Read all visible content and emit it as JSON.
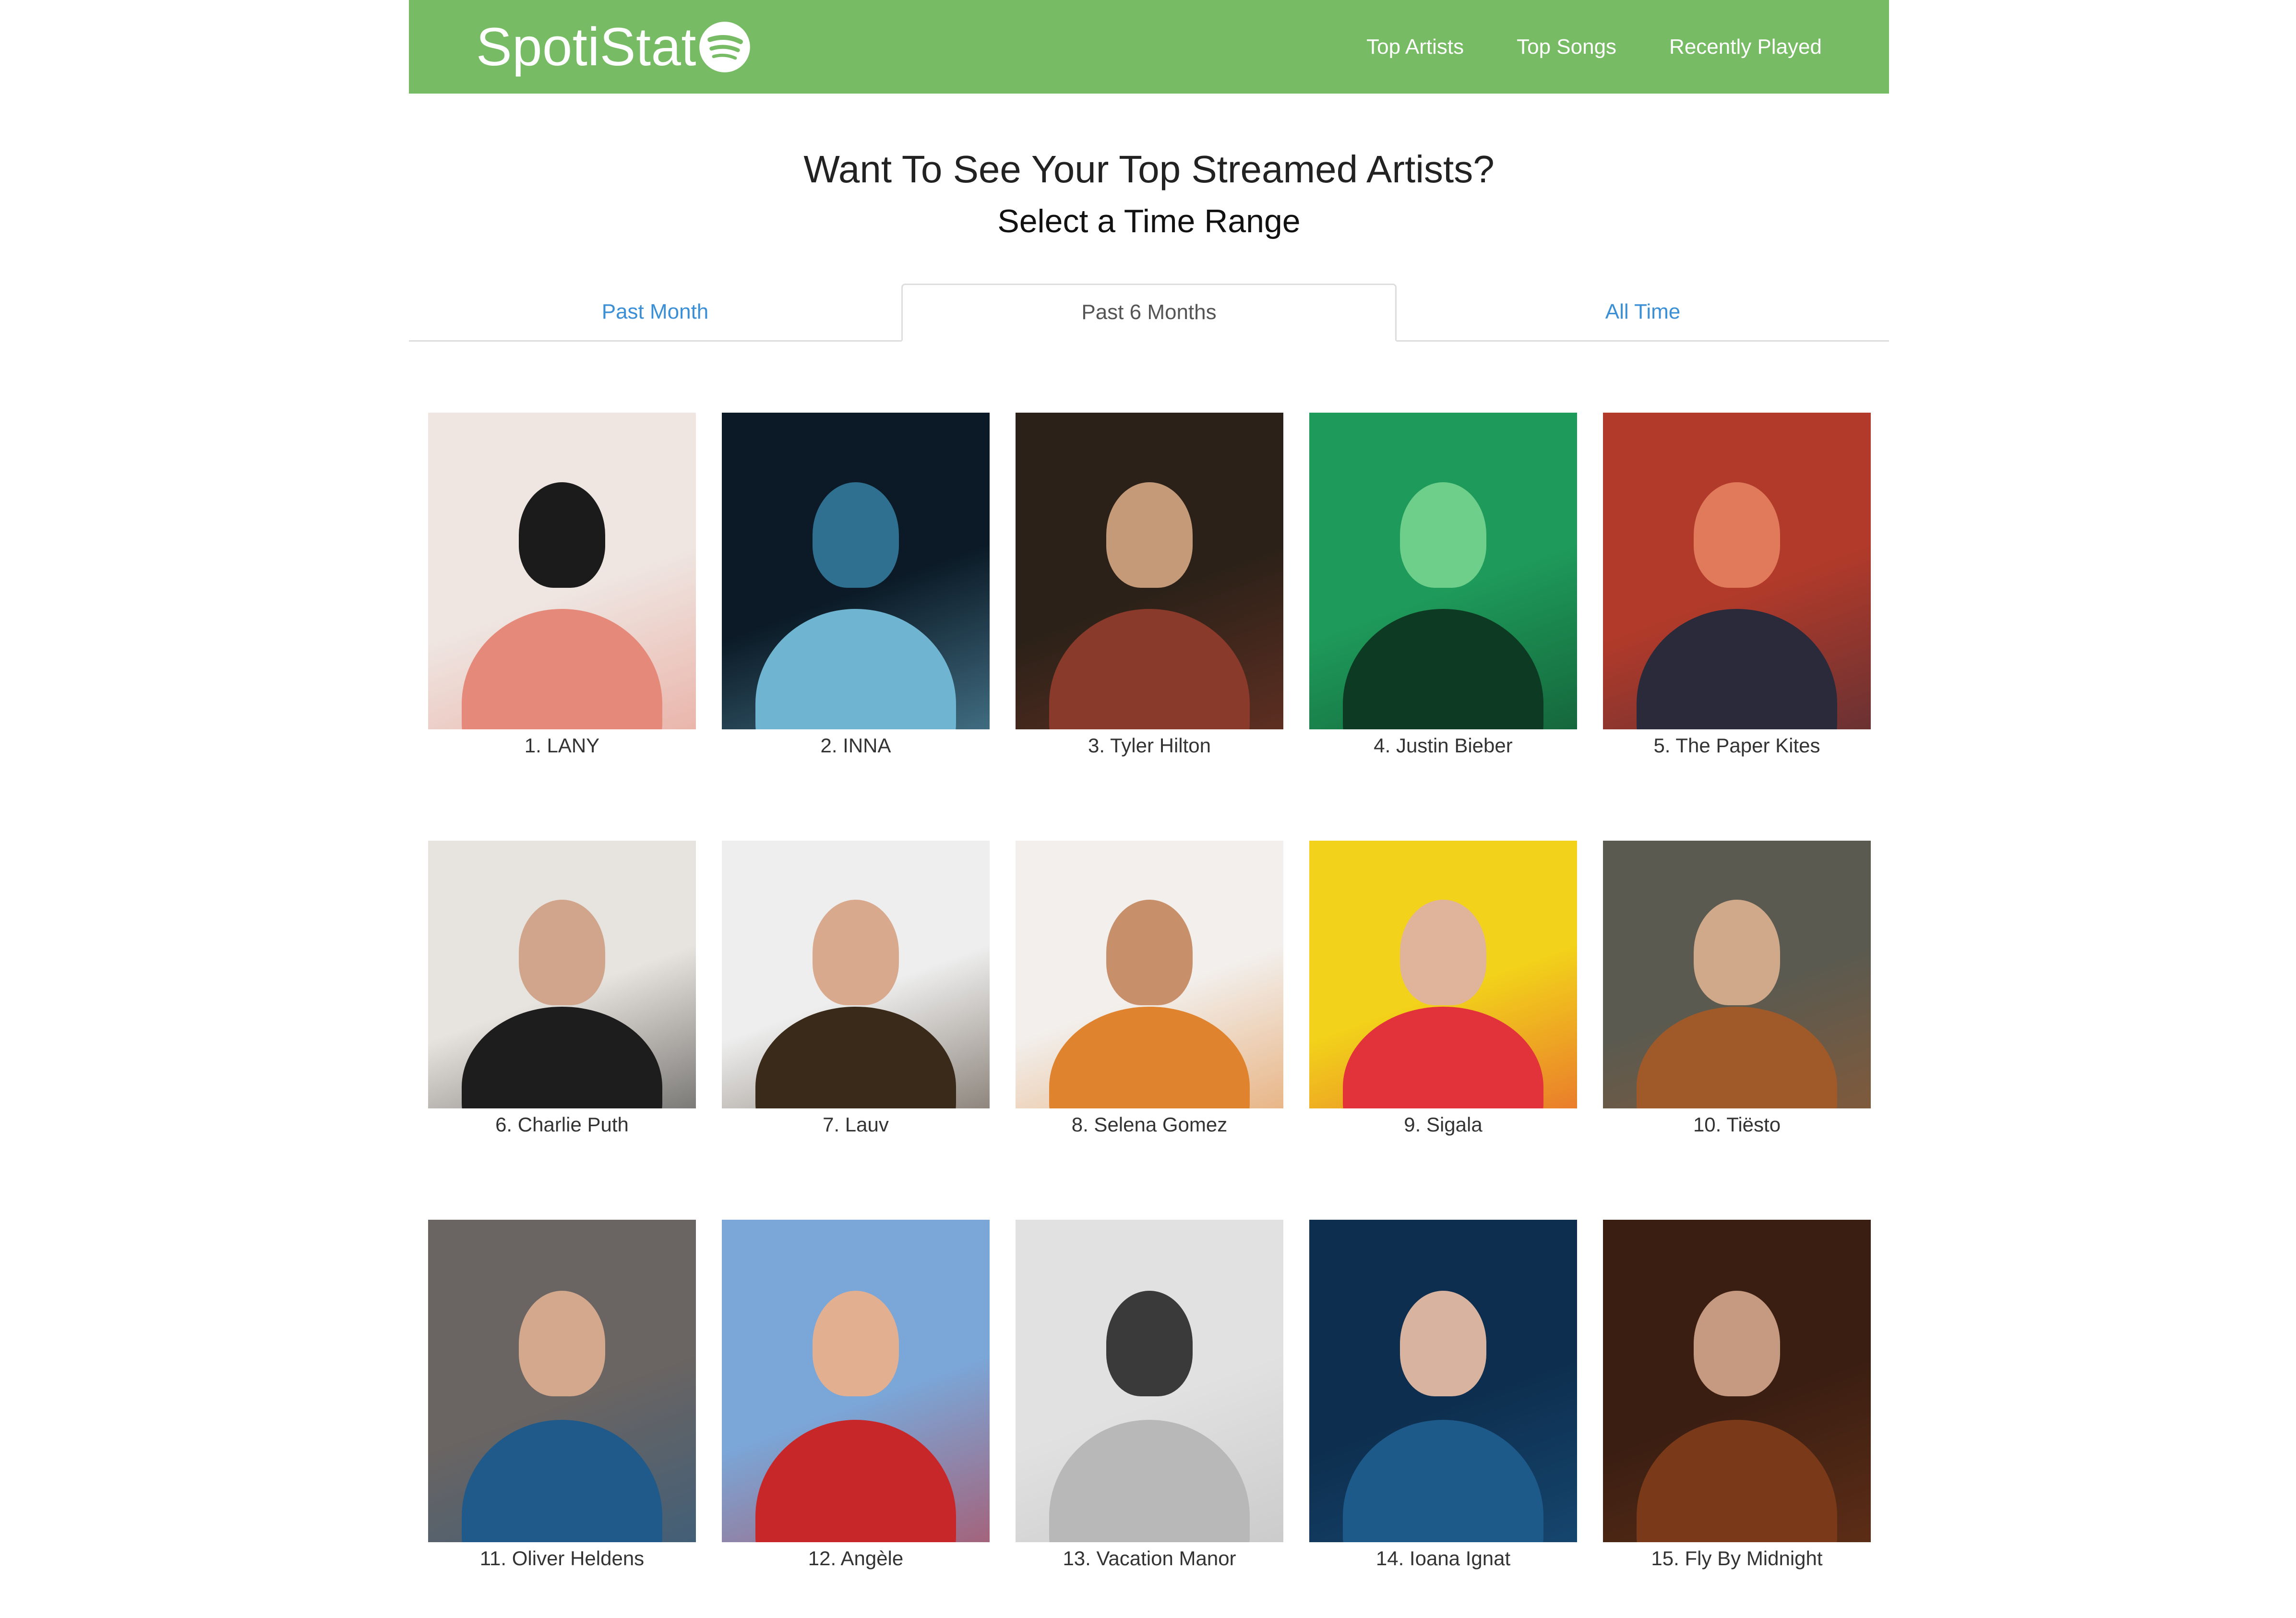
{
  "brand": {
    "name": "SpotiStat",
    "logo_icon": "spotify-logo-icon",
    "nav_color": "#77bb64"
  },
  "nav": {
    "links": [
      "Top Artists",
      "Top Songs",
      "Recently Played"
    ]
  },
  "hero": {
    "title": "Want To See Your Top Streamed Artists?",
    "subtitle": "Select a Time Range"
  },
  "tabs": {
    "items": [
      "Past Month",
      "Past 6 Months",
      "All Time"
    ],
    "active": "Past 6 Months",
    "link_color": "#3a8fd6"
  },
  "artists": [
    {
      "label": "1. LANY",
      "bg": "#efe6e2",
      "fg": "#1b1b1b",
      "accent": "#e58a7a"
    },
    {
      "label": "2. INNA",
      "bg": "#0b1a26",
      "fg": "#2f6f8f",
      "accent": "#6fb4d0"
    },
    {
      "label": "3. Tyler Hilton",
      "bg": "#2b2118",
      "fg": "#c59a78",
      "accent": "#8a3a2a"
    },
    {
      "label": "4. Justin Bieber",
      "bg": "#1e9a5a",
      "fg": "#6ecf8a",
      "accent": "#0d3a22"
    },
    {
      "label": "5. The Paper Kites",
      "bg": "#b23a2a",
      "fg": "#e07a5a",
      "accent": "#2a2a3a"
    },
    {
      "label": "6. Charlie Puth",
      "bg": "#e7e3de",
      "fg": "#d1a58c",
      "accent": "#1d1d1d"
    },
    {
      "label": "7. Lauv",
      "bg": "#eeeeee",
      "fg": "#d9a98e",
      "accent": "#3a2a1a"
    },
    {
      "label": "8. Selena Gomez",
      "bg": "#f2efec",
      "fg": "#c78f6a",
      "accent": "#e0832e"
    },
    {
      "label": "9. Sigala",
      "bg": "#f2d21a",
      "fg": "#e0b49a",
      "accent": "#e2323a"
    },
    {
      "label": "10. Tiësto",
      "bg": "#5a5a50",
      "fg": "#d0a98a",
      "accent": "#a05a2a"
    },
    {
      "label": "11. Oliver Heldens",
      "bg": "#6a6462",
      "fg": "#d3a88c",
      "accent": "#1f5a8a"
    },
    {
      "label": "12. Angèle",
      "bg": "#7aa7d8",
      "fg": "#e2b090",
      "accent": "#c8272a"
    },
    {
      "label": "13. Vacation Manor",
      "bg": "#e1e1e1",
      "fg": "#3a3a3a",
      "accent": "#b8b8b8"
    },
    {
      "label": "14. Ioana Ignat",
      "bg": "#0d2e4e",
      "fg": "#d8b4a0",
      "accent": "#1d5a8a"
    },
    {
      "label": "15. Fly By Midnight",
      "bg": "#3a1e12",
      "fg": "#c69a80",
      "accent": "#7a3a1a"
    }
  ]
}
